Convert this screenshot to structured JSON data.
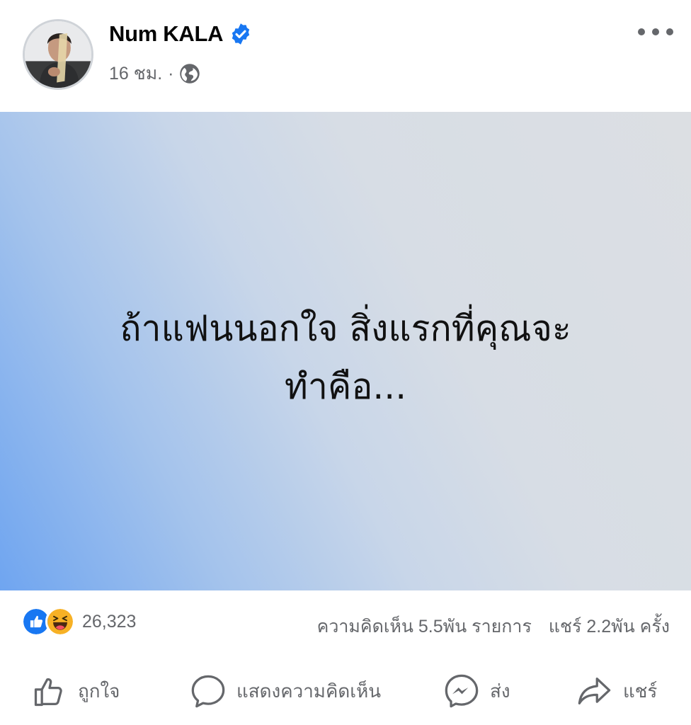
{
  "post": {
    "author": "Num KALA",
    "time": "16 ชม.",
    "separator": "·",
    "text_line1": "ถ้าแฟนนอกใจ สิ่งแรกที่คุณจะ",
    "text_line2": "ทำคือ..."
  },
  "stats": {
    "reaction_count": "26,323",
    "comments": "ความคิดเห็น 5.5พัน รายการ",
    "shares": "แชร์ 2.2พัน ครั้ง"
  },
  "actions": {
    "like": "ถูกใจ",
    "comment": "แสดงความคิดเห็น",
    "send": "ส่ง",
    "share": "แชร์"
  },
  "icons": {
    "verified": "verified-badge-icon",
    "privacy": "globe-icon",
    "more": "more-options-icon",
    "reaction_like": "like-reaction-icon",
    "reaction_haha": "haha-reaction-icon"
  },
  "colors": {
    "accent": "#1877f2",
    "muted": "#65676b",
    "haha": "#f7b125"
  }
}
